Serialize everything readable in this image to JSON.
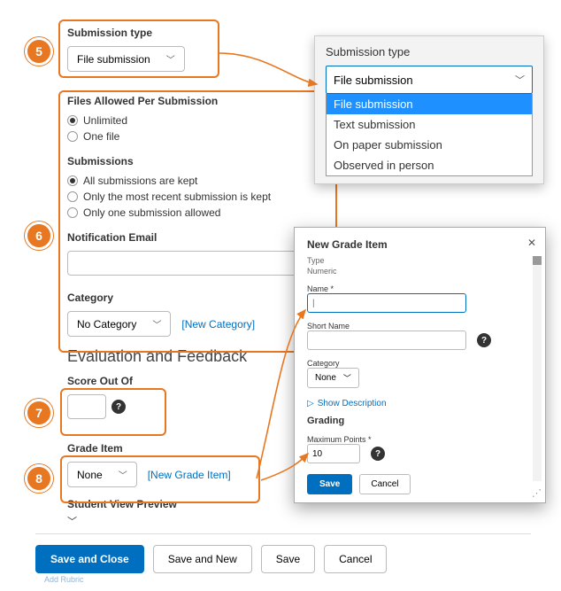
{
  "badges": {
    "b5": "5",
    "b6": "6",
    "b7": "7",
    "b8": "8"
  },
  "submission_type": {
    "label": "Submission type",
    "value": "File submission"
  },
  "files_allowed": {
    "label": "Files Allowed Per Submission",
    "options": [
      "Unlimited",
      "One file"
    ],
    "selected": 0
  },
  "submissions": {
    "label": "Submissions",
    "options": [
      "All submissions are kept",
      "Only the most recent submission is kept",
      "Only one submission allowed"
    ],
    "selected": 0
  },
  "notification": {
    "label": "Notification Email",
    "value": ""
  },
  "category": {
    "label": "Category",
    "value": "No Category",
    "new_link": "[New Category]"
  },
  "eval_heading": "Evaluation and Feedback",
  "score": {
    "label": "Score Out Of",
    "value": ""
  },
  "grade_item": {
    "label": "Grade Item",
    "value": "None",
    "new_link": "[New Grade Item]"
  },
  "svp": {
    "label": "Student View Preview"
  },
  "footer": {
    "save_close": "Save and Close",
    "save_new": "Save and New",
    "save": "Save",
    "cancel": "Cancel",
    "add_rubric": "Add Rubric"
  },
  "popout1": {
    "label": "Submission type",
    "selected": "File submission",
    "options": [
      "File submission",
      "Text submission",
      "On paper submission",
      "Observed in person"
    ]
  },
  "popout2": {
    "title": "New Grade Item",
    "type_label": "Type",
    "type_value": "Numeric",
    "name_label": "Name *",
    "name_value": "",
    "short_label": "Short Name",
    "short_value": "",
    "cat_label": "Category",
    "cat_value": "None",
    "show_desc": "Show Description",
    "grading_h": "Grading",
    "max_label": "Maximum Points *",
    "max_value": "10",
    "save": "Save",
    "cancel": "Cancel"
  }
}
